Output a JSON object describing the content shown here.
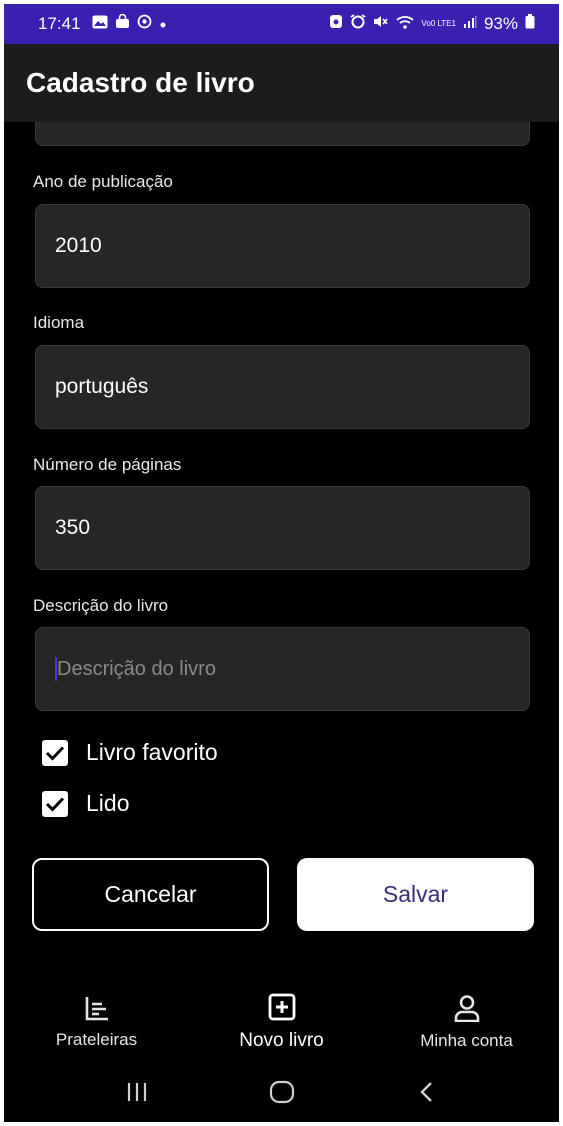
{
  "status_bar": {
    "time": "17:41",
    "battery": "93%",
    "network": "Vo0 LTE1"
  },
  "app_bar": {
    "title": "Cadastro de livro"
  },
  "form": {
    "year": {
      "label": "Ano de publicação",
      "value": "2010"
    },
    "language": {
      "label": "Idioma",
      "value": "português"
    },
    "pages": {
      "label": "Número de páginas",
      "value": "350"
    },
    "description": {
      "label": "Descrição do livro",
      "placeholder": "Descrição do livro",
      "value": ""
    },
    "favorite": {
      "label": "Livro favorito",
      "checked": true
    },
    "read": {
      "label": "Lido",
      "checked": true
    }
  },
  "actions": {
    "cancel_label": "Cancelar",
    "save_label": "Salvar"
  },
  "bottom_nav": [
    {
      "label": "Prateleiras",
      "icon": "shelves-icon",
      "active": false
    },
    {
      "label": "Novo livro",
      "icon": "add-box-icon",
      "active": true
    },
    {
      "label": "Minha conta",
      "icon": "person-icon",
      "active": false
    }
  ],
  "colors": {
    "status_bar": "#3b1fb0",
    "app_bar": "#1c1c1c",
    "field_bg": "#262626",
    "save_text": "#3b2d7a",
    "caret": "#4a3bd8"
  }
}
